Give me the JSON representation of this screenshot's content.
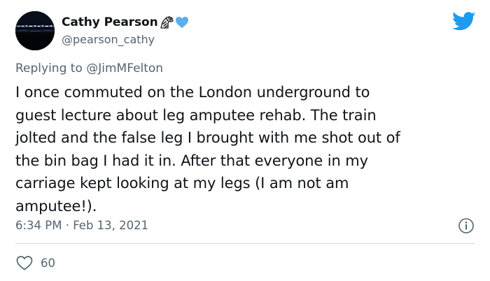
{
  "author": {
    "display_name": "Cathy Pearson",
    "handle": "@pearson_cathy",
    "emoji_icons": [
      "zebra-icon",
      "blue-heart-icon"
    ]
  },
  "reply": {
    "prefix": "Replying to",
    "mention": "@JimMFelton"
  },
  "tweet": {
    "lines": [
      "I once commuted on the London underground to",
      "guest lecture about leg amputee rehab. The train",
      "jolted and the false leg I brought with me shot out of",
      "the bin bag I had it in. After that everyone in my",
      "carriage kept looking at my legs (I am not am",
      "amputee!)."
    ],
    "timestamp": "6:34 PM · Feb 13, 2021"
  },
  "engagement": {
    "like_count": "60"
  },
  "colors": {
    "brand": "#1d9bf0",
    "secondary_text": "#536471",
    "primary_text": "#0f1419",
    "divider": "#cfd9de"
  }
}
